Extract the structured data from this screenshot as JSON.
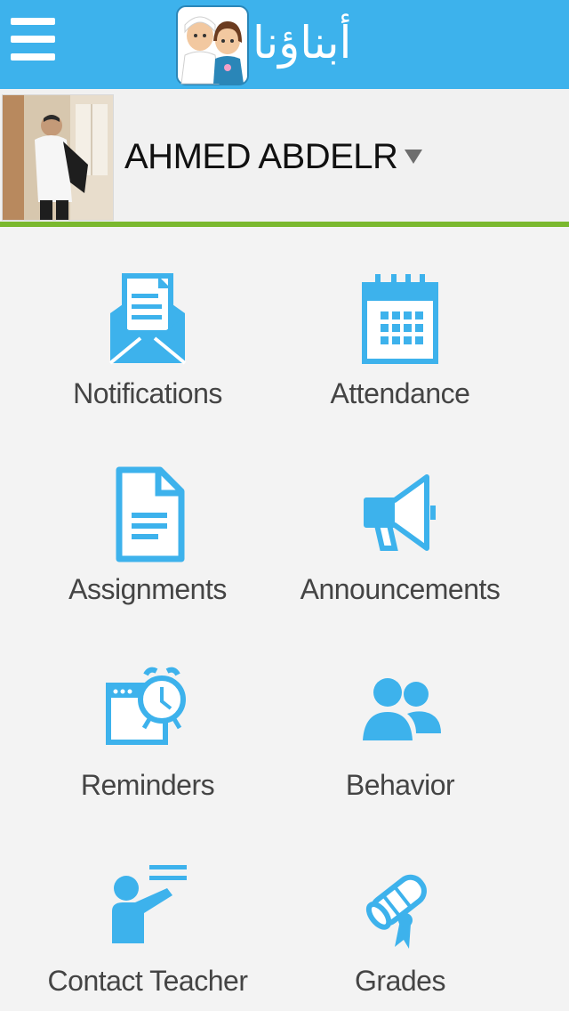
{
  "header": {
    "menu_icon": "hamburger-menu-icon",
    "logo_icon": "two-children-logo-icon",
    "app_name": "أبناؤنا"
  },
  "profile": {
    "avatar_icon": "student-photo",
    "student_name": "AHMED ABDELR",
    "dropdown_icon": "caret-down-icon"
  },
  "menu": [
    {
      "label": "Notifications",
      "icon": "envelope-document-icon"
    },
    {
      "label": "Attendance",
      "icon": "calendar-icon"
    },
    {
      "label": "Assignments",
      "icon": "document-icon"
    },
    {
      "label": "Announcements",
      "icon": "megaphone-icon"
    },
    {
      "label": "Reminders",
      "icon": "alarm-clock-icon"
    },
    {
      "label": "Behavior",
      "icon": "people-icon"
    },
    {
      "label": "Contact Teacher",
      "icon": "teacher-board-icon"
    },
    {
      "label": "Grades",
      "icon": "diploma-scroll-icon"
    }
  ],
  "colors": {
    "header_bg": "#3db2ec",
    "icon_blue": "#3db2ec",
    "accent_green": "#7ab82e",
    "background": "#f3f3f3",
    "label_text": "#444444"
  }
}
